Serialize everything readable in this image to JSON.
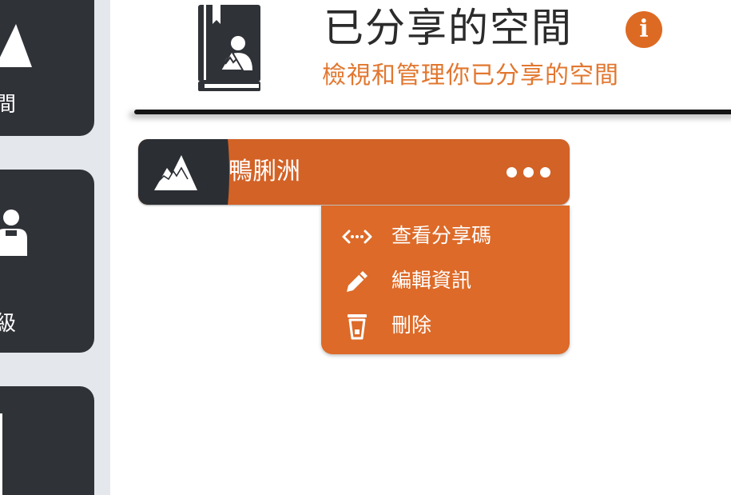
{
  "sidebar": {
    "items": [
      {
        "label": "間",
        "icon": "mountain-icon"
      },
      {
        "label": "級",
        "icon": "user-icon"
      },
      {
        "label": "",
        "icon": "document-icon"
      }
    ]
  },
  "header": {
    "icon": "shared-book-icon",
    "title": "已分享的空間",
    "info_icon": "i",
    "subtitle": "檢視和管理你已分享的空間"
  },
  "spaces": [
    {
      "name": "鴨脷洲",
      "thumbnail_icon": "mountain-icon",
      "more_icon": "more-dots-icon"
    }
  ],
  "menu": {
    "items": [
      {
        "label": "查看分享碼",
        "icon": "code-icon"
      },
      {
        "label": "編輯資訊",
        "icon": "pencil-icon"
      },
      {
        "label": "刪除",
        "icon": "trash-icon"
      }
    ]
  },
  "colors": {
    "accent": "#d36226",
    "menu_background": "#dd6a28",
    "subtitle": "#e2772f",
    "info_icon": "#dd6a23",
    "sidebar_tile": "#2f3237",
    "sidebar_background": "#e4e7eb"
  }
}
